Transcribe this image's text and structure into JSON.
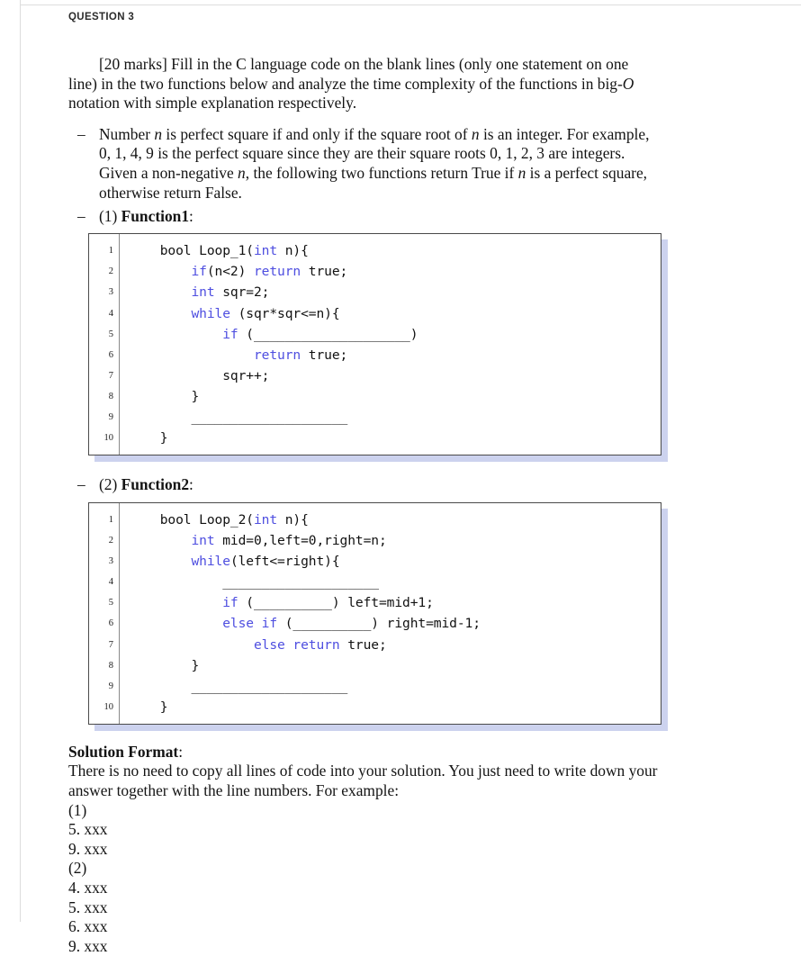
{
  "header": {
    "question_label": "QUESTION 3"
  },
  "intro": {
    "paragraph_html": "<span class=\"indent-first\">[20 marks] Fill in the C language code on the blank lines (only one statement on one line) in the two functions below and analyze the time complexity of the functions in big-<em class=\"var\">O</em> notation with simple explanation respectively.</span>",
    "paragraph_text": "[20 marks] Fill in the C language code on the blank lines (only one statement on one line) in the two functions below and analyze the time complexity of the functions in big-O notation with simple explanation respectively."
  },
  "bullets": [
    {
      "dash": "–",
      "html": "Number <em class=\"var\">n</em> is perfect square if and only if the square root of <em class=\"var\">n</em> is an integer. For example, 0, 1, 4, 9 is the perfect square since they are their square roots 0, 1, 2, 3 are integers. Given a non-negative <em class=\"var\">n</em>, the following two functions return True if <em class=\"var\">n</em> is a perfect square, otherwise return False.",
      "text": "Number n is perfect square if and only if the square root of n is an integer. For example, 0, 1, 4, 9 is the perfect square since they are their square roots 0, 1, 2, 3 are integers. Given a non-negative n, the following two functions return True if n is a perfect square, otherwise return False."
    },
    {
      "dash": "–",
      "html": "(1) <strong class=\"fname\">Function1</strong>:",
      "text": "(1) Function1:"
    },
    {
      "dash": "–",
      "html": "(2) <strong class=\"fname\">Function2</strong>:",
      "text": "(2) Function2:"
    }
  ],
  "code_blocks": [
    {
      "name": "function1",
      "line_numbers": [
        "1",
        "2",
        "3",
        "4",
        "5",
        "6",
        "7",
        "8",
        "9",
        "10"
      ],
      "lines_html": "    bool Loop_1(<span class=\"kw\">int</span> n){\n        <span class=\"kw\">if</span>(n&lt;2) <span class=\"kw\">return</span> true;\n        <span class=\"kw\">int</span> sqr=2;\n        <span class=\"kw\">while</span> (sqr*sqr&lt;=n){\n            <span class=\"kw\">if</span> (____________________)\n                <span class=\"kw\">return</span> true;\n            sqr++;\n        }\n        ____________________\n    }",
      "lines_text": [
        "    bool Loop_1(int n){",
        "        if(n<2) return true;",
        "        int sqr=2;",
        "        while (sqr*sqr<=n){",
        "            if (____________________)",
        "                return true;",
        "            sqr++;",
        "        }",
        "        ____________________",
        "    }"
      ]
    },
    {
      "name": "function2",
      "line_numbers": [
        "1",
        "2",
        "3",
        "4",
        "5",
        "6",
        "7",
        "8",
        "9",
        "10"
      ],
      "lines_html": "    bool Loop_2(<span class=\"kw\">int</span> n){\n        <span class=\"kw\">int</span> mid=0,left=0,right=n;\n        <span class=\"kw\">while</span>(left&lt;=right){\n            ____________________\n            <span class=\"kw\">if</span> (__________) left=mid+1;\n            <span class=\"kw\">else</span> <span class=\"kw\">if</span> (__________) right=mid-1;\n                <span class=\"kw\">else</span> <span class=\"kw\">return</span> true;\n        }\n        ____________________\n    }",
      "lines_text": [
        "    bool Loop_2(int n){",
        "        int mid=0,left=0,right=n;",
        "        while(left<=right){",
        "            ____________________",
        "            if (__________) left=mid+1;",
        "            else if (__________) right=mid-1;",
        "                else return true;",
        "        }",
        "        ____________________",
        "    }"
      ]
    }
  ],
  "solution": {
    "title": "Solution Format",
    "title_colon": ":",
    "paragraph": "There is no need to copy all lines of code into your solution. You just need to write down your answer together with the line numbers. For example:",
    "answer_lines": [
      "(1)",
      "5. xxx",
      "9. xxx",
      "(2)",
      "4. xxx",
      "5. xxx",
      "6. xxx",
      "9. xxx"
    ]
  },
  "colors": {
    "keyword_blue": "#4e4ee0",
    "code_shadow": "#ccd2ee",
    "code_border": "#4a4a4a",
    "page_border": "#dcdcdc",
    "text": "#141414"
  }
}
